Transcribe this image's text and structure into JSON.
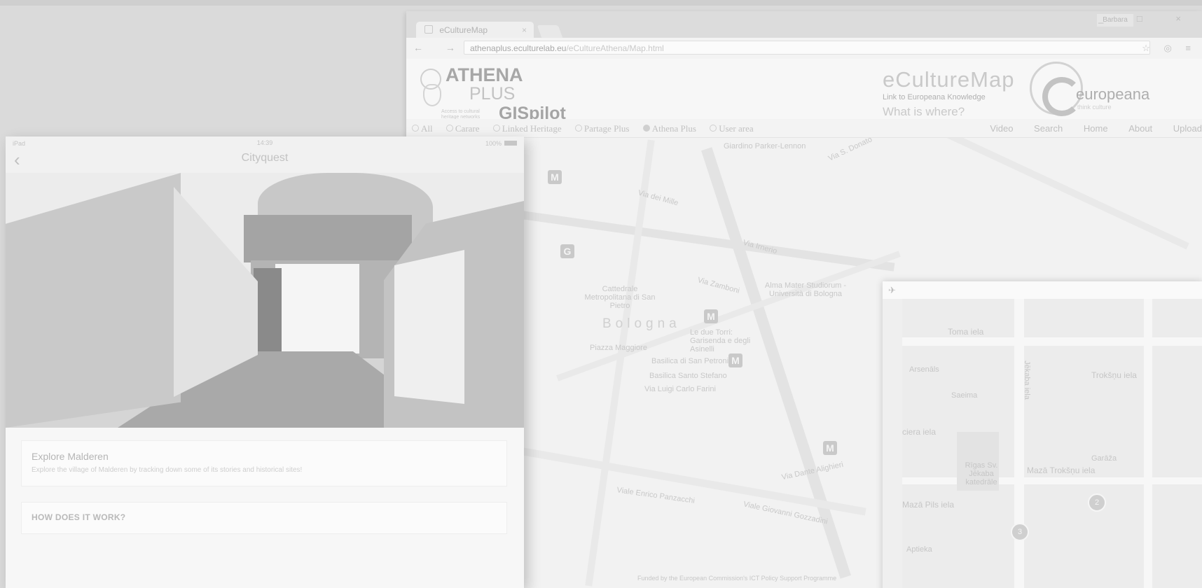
{
  "browser": {
    "tab_title": "eCultureMap",
    "tab_close": "×",
    "user_name": "Barbara",
    "window_buttons": "_ □ ×",
    "nav_icons": "← → C",
    "url_host": "athenaplus.eculturelab.eu",
    "url_path": "/eCultureAthena/Map.html",
    "ext_icons": "☆ ◎ ≡"
  },
  "site": {
    "athena": "ATHENA",
    "plus": "PLUS",
    "athena_tagline": "Access to cultural heritage networks for Europeana",
    "gispilot": "GISpilot",
    "ecm_title": "eCultureMap",
    "ecm_subtitle": "Link to Europeana Knowledge",
    "ecm_question": "What is where?",
    "europeana": "europeana",
    "europeana_tag": "think culture",
    "filters": [
      "All",
      "Carare",
      "Linked Heritage",
      "Partage Plus",
      "Athena Plus",
      "User area"
    ],
    "menu": [
      "Video",
      "Search",
      "Home",
      "About",
      "Upload"
    ],
    "funded": "Funded by the European Commission's ICT Policy Support Programme"
  },
  "map_labels": {
    "city": "Bologna",
    "giardino": "Giardino Parker-Lennon",
    "donato": "Via S. Donato",
    "cattedrale": "Cattedrale Metropolitana di San Pietro",
    "alma": "Alma Mater Studiorum - Università di Bologna",
    "torri": "Le due Torri: Garisenda e degli Asinelli",
    "piazza": "Piazza Maggiore",
    "petronio": "Basilica di San Petronio",
    "stefano": "Basilica Santo Stefano",
    "farini": "Via Luigi Carlo Farini",
    "panzacchi": "Viale Enrico Panzacchi",
    "gozzadini": "Viale Giovanni Gozzadini",
    "zamboni": "Via Zamboni",
    "irnerio": "Via Irnerio",
    "mille": "Via dei Mille",
    "dante": "Via Dante Alighieri",
    "pins": [
      "M",
      "G",
      "M",
      "M",
      "M",
      "M"
    ]
  },
  "inset": {
    "plane": "✈",
    "labels": [
      "Toma iela",
      "Trokšņu iela",
      "Arsenāls",
      "Saeima",
      "ciera iela",
      "Rīgas Sv. Jēkaba katedrāle",
      "Mazā Trokšņu iela",
      "Garāža",
      "Mazā Pils iela",
      "Aptieka",
      "Jēkaba iela"
    ],
    "circles": [
      "3",
      "2"
    ]
  },
  "tablet": {
    "status_left": "iPad",
    "status_time": "14:39",
    "status_right": "100%",
    "back": "‹",
    "app_title": "Cityquest",
    "card1_title": "Explore Malderen",
    "card1_desc": "Explore the village of Malderen by tracking down some of its stories and historical sites!",
    "card2_title": "HOW DOES IT WORK?"
  }
}
